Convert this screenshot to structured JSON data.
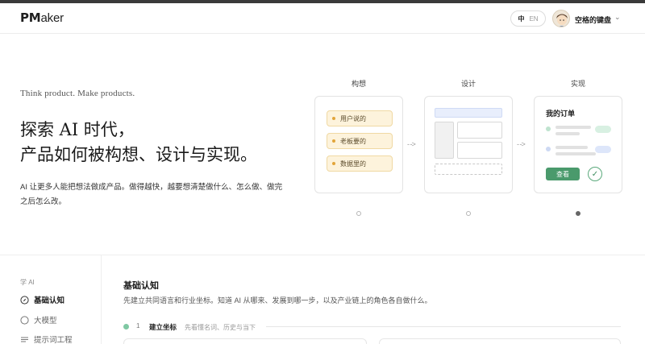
{
  "header": {
    "logo_bold": "PM",
    "logo_rest": "aker",
    "lang_active": "中",
    "lang_inactive": "EN",
    "user_name": "空格的键盘",
    "user_chevron": "⌄"
  },
  "hero": {
    "tagline": "Think product. Make products.",
    "headline_line1": "探索 AI 时代，",
    "headline_line2": "产品如何被构想、设计与实现。",
    "desc": "AI 让更多人能把想法做成产品。做得越快，越要想清楚做什么、怎么做、做完之后怎么改。",
    "stages": [
      {
        "label": "构想"
      },
      {
        "label": "设计"
      },
      {
        "label": "实现"
      }
    ],
    "ideas": [
      "用户说的",
      "老板要的",
      "数据里的"
    ],
    "order_title": "我的订单",
    "order_button": "查看",
    "arrow": "- ->",
    "carousel_active_index": 2
  },
  "sidebar": {
    "heading": "学 AI",
    "items": [
      {
        "label": "基础认知",
        "icon": "compass-icon",
        "active": true
      },
      {
        "label": "大模型",
        "icon": "circle-icon",
        "active": false
      },
      {
        "label": "提示词工程",
        "icon": "list-icon",
        "active": false
      }
    ]
  },
  "main": {
    "title": "基础认知",
    "desc": "先建立共同语言和行业坐标。知道 AI 从哪来、发展到哪一步，以及产业链上的角色各自做什么。",
    "step_number": "1",
    "step_title": "建立坐标",
    "step_sub": "先看懂名词、历史与当下"
  },
  "colors": {
    "accent_green": "#4a9a6c",
    "note_yellow": "#fdf3dc",
    "wire_blue": "#e8eefc"
  }
}
